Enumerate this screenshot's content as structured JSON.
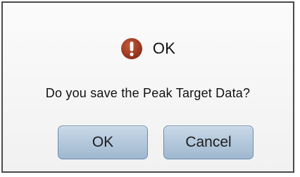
{
  "dialog": {
    "title": "OK",
    "icon": "exclamation-icon",
    "icon_color": "#9b3a22",
    "message": "Do you save the Peak Target Data?",
    "buttons": {
      "ok_label": "OK",
      "cancel_label": "Cancel"
    }
  }
}
